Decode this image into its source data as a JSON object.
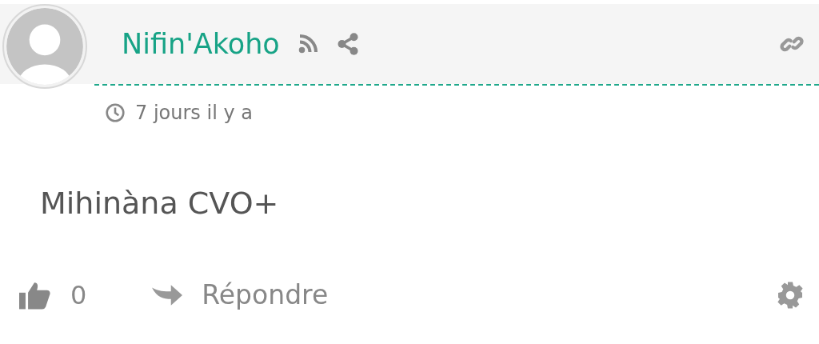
{
  "comment": {
    "author": "Nifin'Akoho",
    "time": "7 jours il y a",
    "text": "Mihinàna CVO+"
  },
  "actions": {
    "likes": "0",
    "reply": "Répondre"
  }
}
